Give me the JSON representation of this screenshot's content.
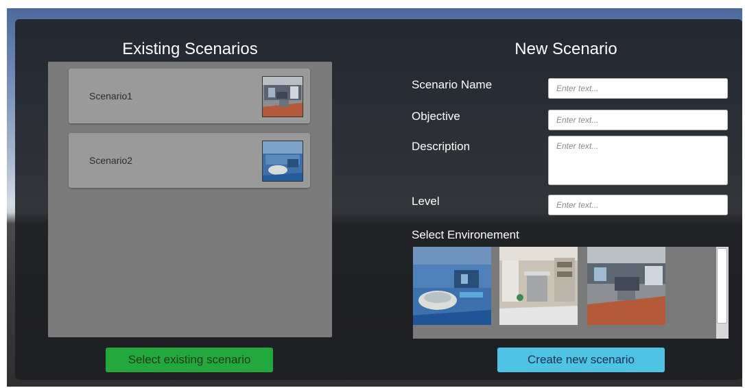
{
  "left": {
    "title": "Existing Scenarios",
    "scenarios": [
      {
        "name": "Scenario1",
        "thumb_icon": "lab-room-thumbnail"
      },
      {
        "name": "Scenario2",
        "thumb_icon": "blue-lab-thumbnail"
      }
    ],
    "select_button": "Select existing scenario"
  },
  "right": {
    "title": "New Scenario",
    "fields": {
      "name_label": "Scenario Name",
      "objective_label": "Objective",
      "description_label": "Description",
      "level_label": "Level",
      "placeholder": "Enter text..."
    },
    "env_label": "Select Environement",
    "create_button": "Create new scenario"
  },
  "colors": {
    "panel": "#1c1e22",
    "select_button": "#22a83d",
    "create_button": "#4fc3e4"
  }
}
